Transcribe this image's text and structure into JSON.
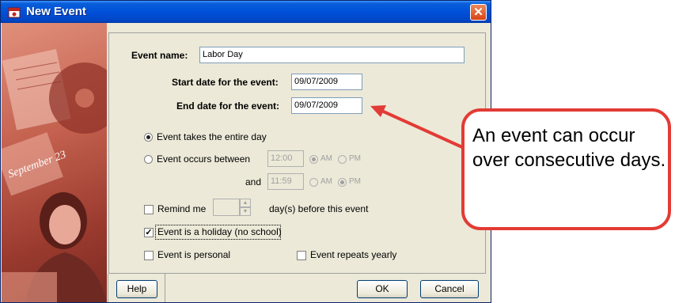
{
  "window": {
    "title": "New Event",
    "close_glyph": "✕"
  },
  "form": {
    "event_name_label": "Event name:",
    "event_name_value": "Labor Day",
    "start_date_label": "Start date for the event:",
    "start_date_value": "09/07/2009",
    "end_date_label": "End date for the event:",
    "end_date_value": "09/07/2009",
    "radio_entire_day": "Event takes the entire day",
    "radio_between": "Event occurs between",
    "time_start_value": "12:00",
    "and_label": "and",
    "time_end_value": "11:59",
    "am_label": "AM",
    "pm_label": "PM",
    "remind_label": "Remind me",
    "remind_suffix": "day(s) before this event",
    "holiday_label": "Event is a holiday (no school)",
    "personal_label": "Event is personal",
    "repeats_label": "Event repeats yearly",
    "holiday_checked": true,
    "personal_checked": false,
    "repeats_checked": false,
    "remind_checked": false,
    "entire_day_selected": true
  },
  "buttons": {
    "help": "Help",
    "ok": "OK",
    "cancel": "Cancel"
  },
  "callout": {
    "text": "An event can occur over consecutive days."
  },
  "photo": {
    "calendar_text": "September 23"
  },
  "colors": {
    "accent_red": "#e33b35",
    "titlebar_blue": "#0050d8",
    "panel": "#ece9d8"
  },
  "icons": [
    "app-icon",
    "close-icon",
    "arrow-pointer"
  ]
}
